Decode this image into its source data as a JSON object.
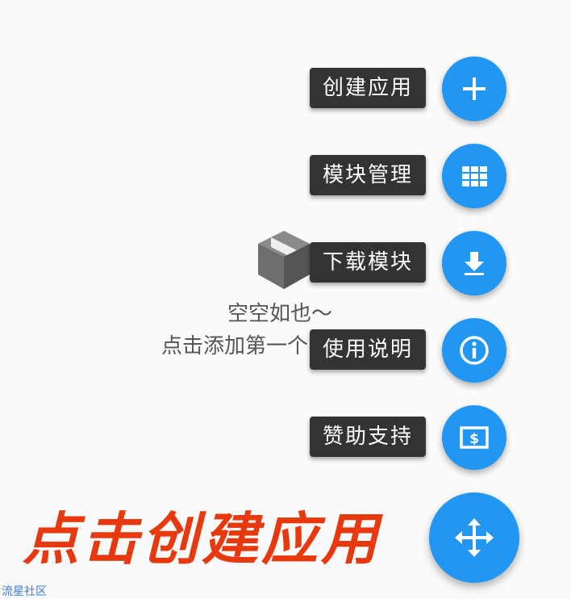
{
  "empty_state": {
    "line1": "空空如也～",
    "line2": "点击添加第一个"
  },
  "speed_dial": {
    "items": [
      {
        "label": "创建应用",
        "icon": "plus-icon"
      },
      {
        "label": "模块管理",
        "icon": "grid-icon"
      },
      {
        "label": "下载模块",
        "icon": "download-icon"
      },
      {
        "label": "使用说明",
        "icon": "info-icon"
      },
      {
        "label": "赞助支持",
        "icon": "dollar-icon"
      }
    ],
    "main_icon": "move-arrows-icon"
  },
  "annotation": "点击创建应用",
  "watermark": "流星社区",
  "colors": {
    "fab": "#2196f3",
    "label_bg": "#333333",
    "annotation": "#e8380d",
    "background": "#fafafa"
  }
}
